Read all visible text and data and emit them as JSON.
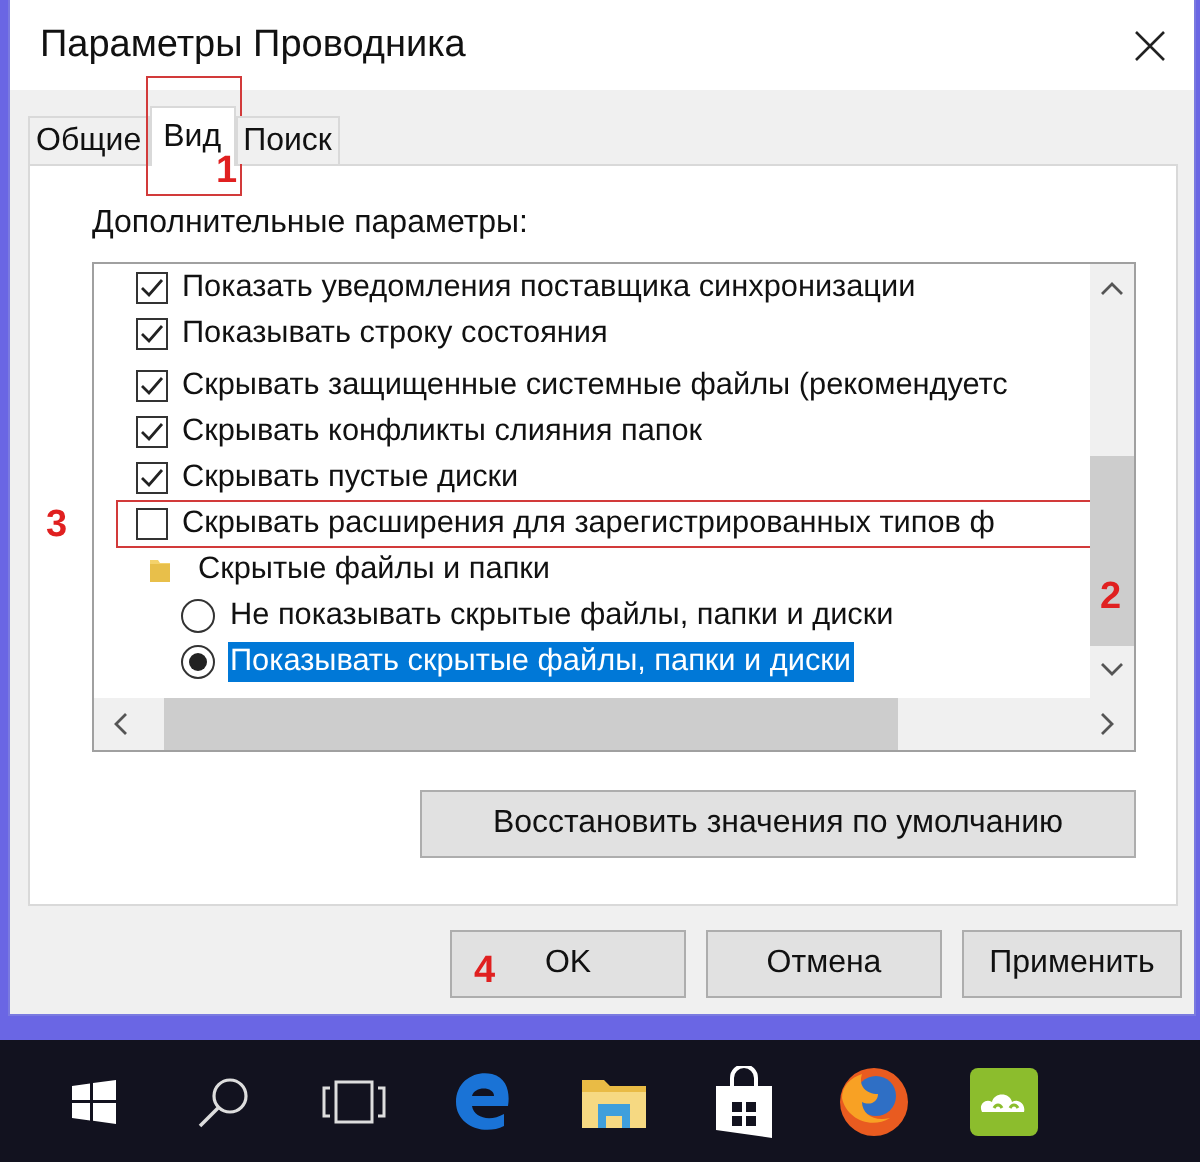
{
  "window": {
    "title": "Параметры Проводника"
  },
  "tabs": [
    {
      "label": "Общие",
      "selected": false
    },
    {
      "label": "Вид",
      "selected": true,
      "callout": "1"
    },
    {
      "label": "Поиск",
      "selected": false
    }
  ],
  "panel": {
    "label": "Дополнительные параметры:",
    "options": [
      {
        "kind": "checkbox",
        "label": "Показать уведомления поставщика синхронизации",
        "checked": true,
        "selected": false
      },
      {
        "kind": "checkbox",
        "label": "Показывать строку состояния",
        "checked": true,
        "selected": false
      },
      {
        "kind": "checkbox",
        "label": "Скрывать защищенные системные файлы (рекомендуетс",
        "checked": true,
        "selected": false
      },
      {
        "kind": "checkbox",
        "label": "Скрывать конфликты слияния папок",
        "checked": true,
        "selected": false
      },
      {
        "kind": "checkbox",
        "label": "Скрывать пустые диски",
        "checked": true,
        "selected": false
      },
      {
        "kind": "checkbox",
        "label": "Скрывать расширения для зарегистрированных типов ф",
        "checked": false,
        "selected": false,
        "callout": "3"
      },
      {
        "kind": "folder",
        "label": "Скрытые файлы и папки",
        "selected": false,
        "children": [
          {
            "kind": "radio",
            "label": "Не показывать скрытые файлы, папки и диски",
            "checked": false,
            "selected": false
          },
          {
            "kind": "radio",
            "label": "Показывать скрытые файлы, папки и диски",
            "checked": true,
            "selected": true
          }
        ]
      }
    ],
    "scrollbar_callout": "2",
    "restore_button": "Восстановить значения по умолчанию"
  },
  "buttons": [
    {
      "label": "OK",
      "callout": "4"
    },
    {
      "label": "Отмена"
    },
    {
      "label": "Применить"
    }
  ],
  "taskbar": {
    "apps": [
      {
        "kind": "start"
      },
      {
        "kind": "search"
      },
      {
        "kind": "taskview"
      },
      {
        "kind": "browser"
      },
      {
        "kind": "folder"
      },
      {
        "kind": "store"
      },
      {
        "kind": "fox"
      },
      {
        "kind": "cloud"
      }
    ]
  }
}
